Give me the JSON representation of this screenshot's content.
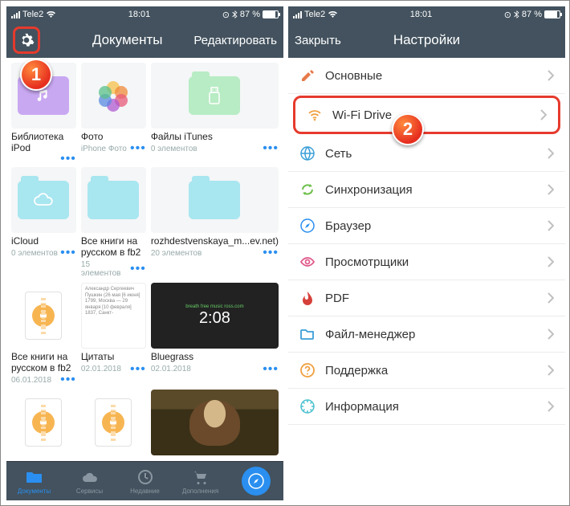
{
  "status": {
    "carrier": "Tele2",
    "time": "18:01",
    "bt": "✱",
    "batt": "87 %"
  },
  "left": {
    "title": "Документы",
    "edit": "Редактировать",
    "tiles": [
      {
        "name": "Библиотека iPod",
        "sub": ""
      },
      {
        "name": "Фото",
        "sub": "iPhone Фото"
      },
      {
        "name": "Файлы iTunes",
        "sub": "0 элементов"
      },
      {
        "name": "iCloud",
        "sub": "0 элементов"
      },
      {
        "name": "Все книги на русском в fb2",
        "sub": "15 элементов"
      },
      {
        "name": "rozhdestvenskaya_m...ev.net)",
        "sub": "20 элементов"
      },
      {
        "name": "Все книги на русском в fb2",
        "sub": "06.01.2018"
      },
      {
        "name": "Цитаты",
        "sub": "02.01.2018"
      },
      {
        "name": "Bluegrass",
        "sub": "02.01.2018"
      }
    ],
    "quote_text": "Александр Сергеевич Пушкин (26 мая [6 июня] 1799, Москва — 29 января [10 февраля] 1837, Санкт-",
    "clock": "2:08",
    "tabs": [
      "Документы",
      "Сервисы",
      "Недавние",
      "Дополнения"
    ]
  },
  "right": {
    "close": "Закрыть",
    "title": "Настройки",
    "rows": [
      {
        "label": "Основные",
        "color": "#e67a4a"
      },
      {
        "label": "Wi-Fi Drive",
        "color": "#f0a040",
        "hl": true
      },
      {
        "label": "Сеть",
        "color": "#3a9fd8"
      },
      {
        "label": "Синхронизация",
        "color": "#6cc04a"
      },
      {
        "label": "Браузер",
        "color": "#2a8ff0"
      },
      {
        "label": "Просмотрщики",
        "color": "#e05a8a"
      },
      {
        "label": "PDF",
        "color": "#d6403a"
      },
      {
        "label": "Файл-менеджер",
        "color": "#3a9fd8"
      },
      {
        "label": "Поддержка",
        "color": "#f0a040"
      },
      {
        "label": "Информация",
        "color": "#4ac0d0"
      }
    ]
  },
  "markers": {
    "one": "1",
    "two": "2"
  }
}
